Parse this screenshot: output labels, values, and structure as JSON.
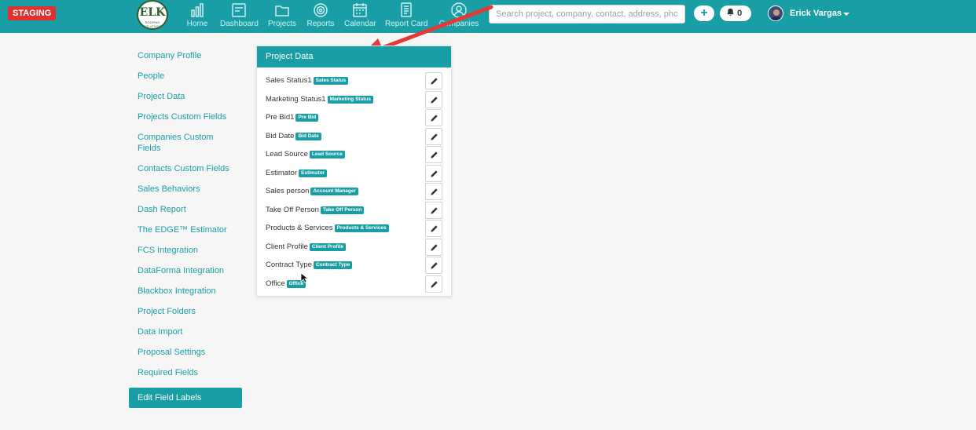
{
  "header": {
    "staging_label": "STAGING",
    "logo_text": "ELK",
    "logo_sub": "ROOFING SOLUTIONS",
    "nav": [
      {
        "label": "Home",
        "icon": "bar-chart-icon"
      },
      {
        "label": "Dashboard",
        "icon": "dashboard-icon"
      },
      {
        "label": "Projects",
        "icon": "folder-icon"
      },
      {
        "label": "Reports",
        "icon": "target-icon"
      },
      {
        "label": "Calendar",
        "icon": "calendar-icon"
      },
      {
        "label": "Report Card",
        "icon": "report-card-icon"
      },
      {
        "label": "Companies",
        "icon": "user-icon"
      }
    ],
    "search_placeholder": "Search project, company, contact, address, phc",
    "plus_label": "+",
    "notification_count": "0",
    "user_name": "Erick Vargas"
  },
  "sidebar": {
    "items": [
      {
        "label": "Company Profile"
      },
      {
        "label": "People"
      },
      {
        "label": "Project Data"
      },
      {
        "label": "Projects Custom Fields"
      },
      {
        "label": "Companies Custom Fields"
      },
      {
        "label": "Contacts Custom Fields"
      },
      {
        "label": "Sales Behaviors"
      },
      {
        "label": "Dash Report"
      },
      {
        "label": "The EDGE™ Estimator"
      },
      {
        "label": "FCS Integration"
      },
      {
        "label": "DataForma Integration"
      },
      {
        "label": "Blackbox Integration"
      },
      {
        "label": "Project Folders"
      },
      {
        "label": "Data Import"
      },
      {
        "label": "Proposal Settings"
      },
      {
        "label": "Required Fields"
      },
      {
        "label": "Edit Field Labels"
      }
    ]
  },
  "panel": {
    "title": "Project Data",
    "rows": [
      {
        "label": "Sales Status1",
        "badge": "Sales Status"
      },
      {
        "label": "Marketing Status1",
        "badge": "Marketing Status"
      },
      {
        "label": "Pre Bid1",
        "badge": "Pre Bid"
      },
      {
        "label": "Bid Date",
        "badge": "Bid Date"
      },
      {
        "label": "Lead Source",
        "badge": "Lead Source"
      },
      {
        "label": "Estimator",
        "badge": "Estimator"
      },
      {
        "label": "Sales person",
        "badge": "Account Manager"
      },
      {
        "label": "Take Off Person",
        "badge": "Take Off Person"
      },
      {
        "label": "Products & Services",
        "badge": "Products & Services"
      },
      {
        "label": "Client Profile",
        "badge": "Client Profile"
      },
      {
        "label": "Contract Type",
        "badge": "Contract Type"
      },
      {
        "label": "Office",
        "badge": "Office"
      }
    ]
  },
  "colors": {
    "brand": "#1a9ea6",
    "staging": "#e03131",
    "annotation_arrow": "#e53935"
  }
}
